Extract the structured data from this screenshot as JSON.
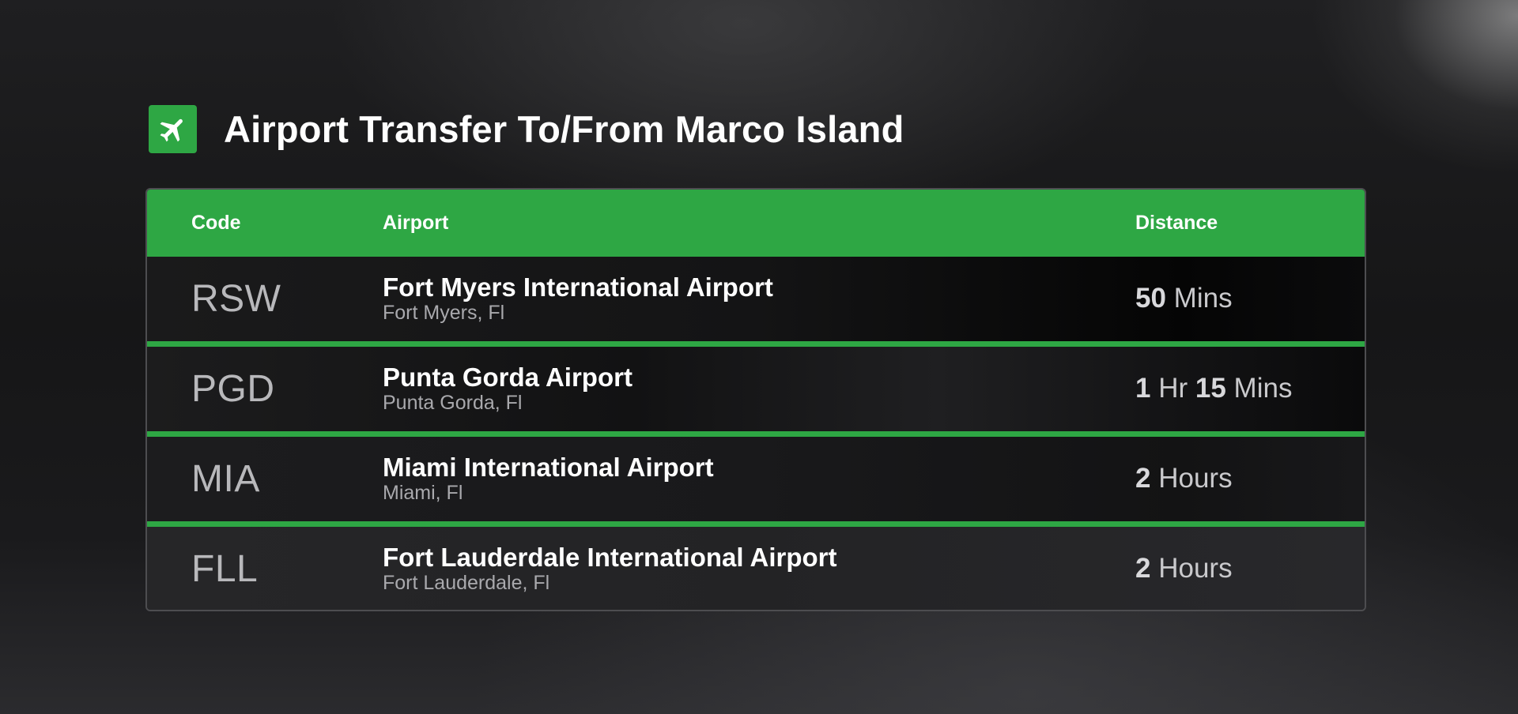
{
  "header": {
    "title": "Airport Transfer To/From Marco Island",
    "icon": "airplane-icon",
    "accent_color": "#2ea744"
  },
  "table": {
    "columns": [
      "Code",
      "Airport",
      "Distance"
    ],
    "rows": [
      {
        "code": "RSW",
        "name": "Fort Myers International Airport",
        "city": "Fort Myers, Fl",
        "distance": [
          {
            "num": "50",
            "unit": "Mins"
          }
        ]
      },
      {
        "code": "PGD",
        "name": "Punta Gorda Airport",
        "city": "Punta Gorda, Fl",
        "distance": [
          {
            "num": "1",
            "unit": "Hr"
          },
          {
            "num": "15",
            "unit": "Mins"
          }
        ]
      },
      {
        "code": "MIA",
        "name": "Miami International Airport",
        "city": "Miami, Fl",
        "distance": [
          {
            "num": "2",
            "unit": "Hours"
          }
        ]
      },
      {
        "code": "FLL",
        "name": "Fort Lauderdale International Airport",
        "city": "Fort Lauderdale, Fl",
        "distance": [
          {
            "num": "2",
            "unit": "Hours"
          }
        ]
      }
    ]
  }
}
